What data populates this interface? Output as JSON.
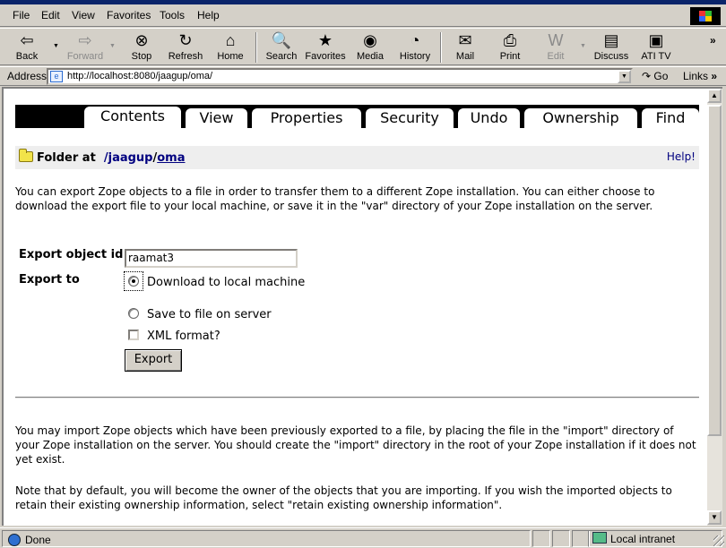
{
  "menu": [
    "File",
    "Edit",
    "View",
    "Favorites",
    "Tools",
    "Help"
  ],
  "toolbar": {
    "back": "Back",
    "forward": "Forward",
    "stop": "Stop",
    "refresh": "Refresh",
    "home": "Home",
    "search": "Search",
    "favorites": "Favorites",
    "media": "Media",
    "history": "History",
    "mail": "Mail",
    "print": "Print",
    "edit": "Edit",
    "discuss": "Discuss",
    "ati_tv": "ATI TV"
  },
  "address": {
    "label": "Address",
    "url": "http://localhost:8080/jaagup/oma/",
    "go": "Go",
    "links": "Links"
  },
  "tabs": [
    {
      "label": "Contents",
      "active": true
    },
    {
      "label": "View"
    },
    {
      "label": "Properties"
    },
    {
      "label": "Security"
    },
    {
      "label": "Undo"
    },
    {
      "label": "Ownership"
    },
    {
      "label": "Find"
    }
  ],
  "location": {
    "prefix": "Folder at",
    "path_root": "/jaagup",
    "sep": "/",
    "path_leaf": "oma",
    "help": "Help!"
  },
  "export_intro": "You can export Zope objects to a file in order to transfer them to a different Zope installation. You can either choose to download the export file to your local machine, or save it in the \"var\" directory of your Zope installation on the server.",
  "form": {
    "export_id_label": "Export object id",
    "export_id_value": "raamat3",
    "export_to_label": "Export to",
    "opt_download": "Download to local machine",
    "opt_server": "Save to file on server",
    "opt_xml": "XML format?",
    "export_button": "Export"
  },
  "import_intro": "You may import Zope objects which have been previously exported to a file, by placing the file in the \"import\" directory of your Zope installation on the server. You should create the \"import\" directory in the root of your Zope installation if it does not yet exist.",
  "ownership_note": "Note that by default, you will become the owner of the objects that you are importing. If you wish the imported objects to retain their existing ownership information, select \"retain existing ownership information\".",
  "status": {
    "text": "Done",
    "zone": "Local intranet"
  }
}
